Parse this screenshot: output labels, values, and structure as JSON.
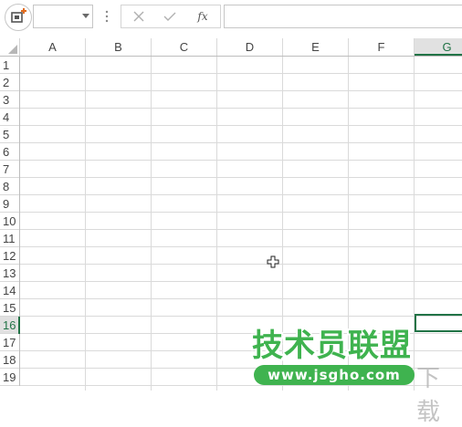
{
  "formula_bar": {
    "name_box_value": "",
    "cancel_icon": "close-icon",
    "enter_icon": "check-icon",
    "function_label": "fx",
    "formula_value": ""
  },
  "columns": [
    "A",
    "B",
    "C",
    "D",
    "E",
    "F",
    "G"
  ],
  "selected_column": "G",
  "rows": [
    "1",
    "2",
    "3",
    "4",
    "5",
    "6",
    "7",
    "8",
    "9",
    "10",
    "11",
    "12",
    "13",
    "14",
    "15",
    "16",
    "17",
    "18",
    "19"
  ],
  "selected_row": "16",
  "active_cell": "G16",
  "watermark": {
    "title": "技术员联盟",
    "url": "www.jsgho.com",
    "side_text": "下载"
  },
  "colors": {
    "accent": "#217346",
    "watermark_green": "#3fb34f",
    "gridline": "#dadada"
  }
}
